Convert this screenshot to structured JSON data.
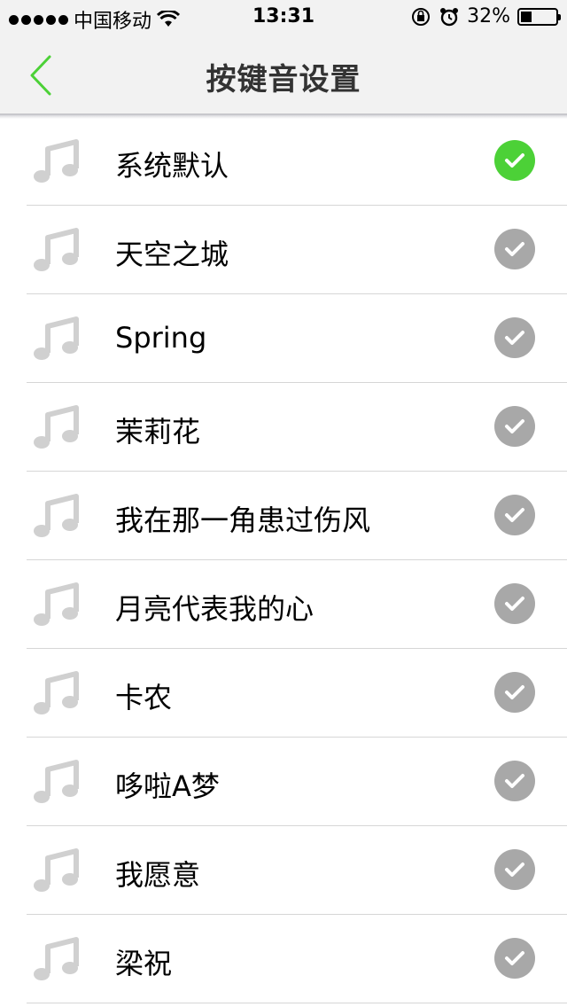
{
  "status_bar": {
    "carrier": "中国移动",
    "time": "13:31",
    "battery_percent": "32%",
    "battery_level": 0.32
  },
  "nav": {
    "title": "按键音设置",
    "back_icon": "chevron-left-icon",
    "accent_color": "#4cd137"
  },
  "ringtones": [
    {
      "label": "系统默认",
      "selected": true
    },
    {
      "label": "天空之城",
      "selected": false
    },
    {
      "label": "Spring",
      "selected": false
    },
    {
      "label": "茉莉花",
      "selected": false
    },
    {
      "label": "我在那一角患过伤风",
      "selected": false
    },
    {
      "label": "月亮代表我的心",
      "selected": false
    },
    {
      "label": "卡农",
      "selected": false
    },
    {
      "label": "哆啦A梦",
      "selected": false
    },
    {
      "label": "我愿意",
      "selected": false
    },
    {
      "label": "梁祝",
      "selected": false
    }
  ]
}
